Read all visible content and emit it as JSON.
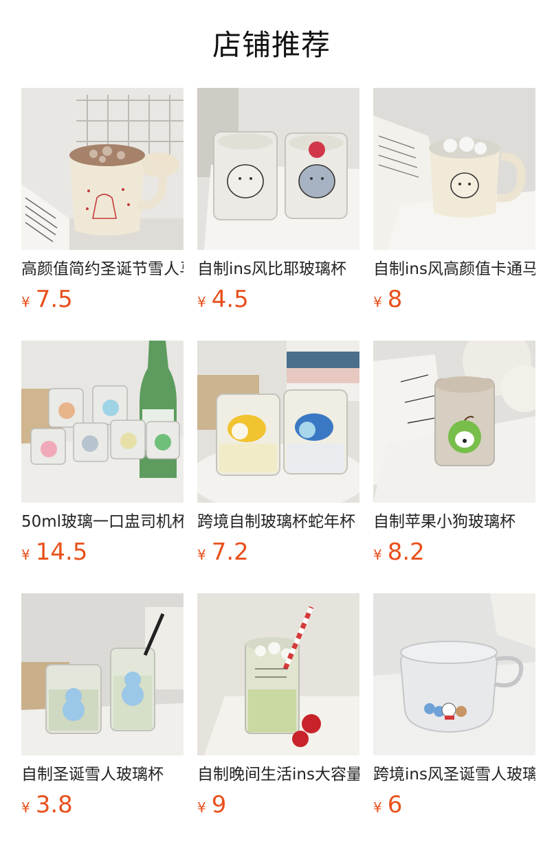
{
  "section": {
    "title": "店铺推荐"
  },
  "products": [
    {
      "name": "高颜值简约圣诞节雪人马克杯",
      "currency": "¥",
      "price": "7.5",
      "image": "cream-mug-snowman-sketch",
      "theme": "#cdb9a4"
    },
    {
      "name": "自制ins风比耶玻璃杯",
      "currency": "¥",
      "price": "4.5",
      "image": "two-glasses-cat-dog-on-tray",
      "theme": "#d8d6d2"
    },
    {
      "name": "自制ins风高颜值卡通马克杯",
      "currency": "¥",
      "price": "8",
      "image": "cream-mug-cat-on-book",
      "theme": "#c9c7c3"
    },
    {
      "name": "50ml玻璃一口盅司机杯",
      "currency": "¥",
      "price": "14.5",
      "image": "six-shot-glasses-soju-bottle",
      "theme": "#b9c6c8"
    },
    {
      "name": "跨境自制玻璃杯蛇年杯",
      "currency": "¥",
      "price": "7.2",
      "image": "two-glasses-snake-prints",
      "theme": "#cfcdc8"
    },
    {
      "name": "自制苹果小狗玻璃杯",
      "currency": "¥",
      "price": "8.2",
      "image": "glass-apple-dog-plush",
      "theme": "#d4d2cd"
    },
    {
      "name": "自制圣诞雪人玻璃杯",
      "currency": "¥",
      "price": "3.8",
      "image": "two-cups-snowman-matcha",
      "theme": "#cbcac5"
    },
    {
      "name": "自制晚间生活ins大容量玻璃杯",
      "currency": "¥",
      "price": "9",
      "image": "tall-glass-straw-tomatoes",
      "theme": "#d9d6cf"
    },
    {
      "name": "跨境ins风圣诞雪人玻璃碗",
      "currency": "¥",
      "price": "6",
      "image": "glass-bowl-snowman-handle",
      "theme": "#cfcfcd"
    }
  ]
}
